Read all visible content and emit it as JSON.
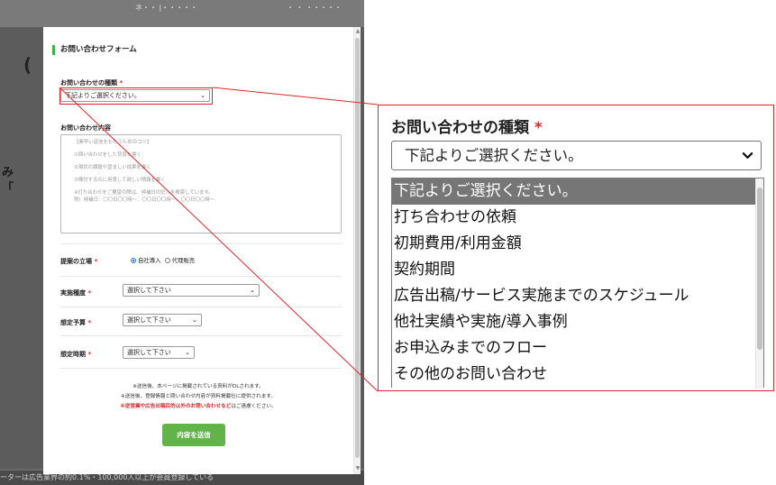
{
  "colors": {
    "accent_red": "#e0262d",
    "accent_green": "#39b54a",
    "button_green": "#62b34a",
    "selected_option_bg": "#767676"
  },
  "background_fragments": {
    "top_text": "ネ・・ |・・・・・",
    "top_right": "・ ・ ・・・・・",
    "left_chars": [
      "み",
      "「",
      "("
    ],
    "bottom_text": "ーターは広告業界の約0.1%・100,000人以上が会員登録している"
  },
  "form": {
    "title": "お問い合わせフォーム",
    "inquiry_type": {
      "label": "お問い合わせの種類",
      "required_mark": "*",
      "value": "下記よりご選択ください。",
      "caret_icon": "chevron-down-icon"
    },
    "inquiry_content": {
      "label": "お問い合わせ内容",
      "placeholder_lines": [
        "【素早い返信をもらうためのコツ】",
        "①問い合わせをした背景を書く",
        "②現状の課題や望ましい成果を書く",
        "③検討するのに用意して欲しい情報を書く",
        "※打ち合わせをご要望の際は、候補日の記入を推奨しています。",
        "例）候補日：〇〇日〇〇時～、〇〇日〇〇時～、〇〇日〇〇時～"
      ]
    },
    "position": {
      "label": "提案の立場",
      "required_mark": "*",
      "options": [
        "自社導入",
        "代理販売"
      ],
      "selected": "自社導入"
    },
    "implementation_type": {
      "label": "実施種度",
      "required_mark": "*",
      "value": "選択して下さい"
    },
    "budget": {
      "label": "想定予算",
      "required_mark": "*",
      "value": "選択して下さい"
    },
    "timing": {
      "label": "想定時期",
      "required_mark": "*",
      "value": "選択して下さい"
    },
    "notes": {
      "line1": "※送信後、本ページに掲載されている資料がDLされます。",
      "line2": "※送信後、登録情報と問い合わせ内容が資料掲載社に提供されます。",
      "line3_prefix": "※",
      "line3_red": "逆営業や広告出稿目的以外のお問い合わせなど",
      "line3_suffix": "はご遠慮ください。"
    },
    "submit_label": "内容を送信"
  },
  "zoom": {
    "title": "お問い合わせの種類",
    "required_mark": "*",
    "select_value": "下記よりご選択ください。",
    "options": [
      "下記よりご選択ください。",
      "打ち合わせの依頼",
      "初期費用/利用金額",
      "契約期間",
      "広告出稿/サービス実施までのスケジュール",
      "他社実績や実施/導入事例",
      "お申込みまでのフロー",
      "その他のお問い合わせ"
    ],
    "selected_index": 0,
    "bleed_text": "※ ・ ・ ・・ ・・ ・・ ・・・・・・・・・"
  }
}
